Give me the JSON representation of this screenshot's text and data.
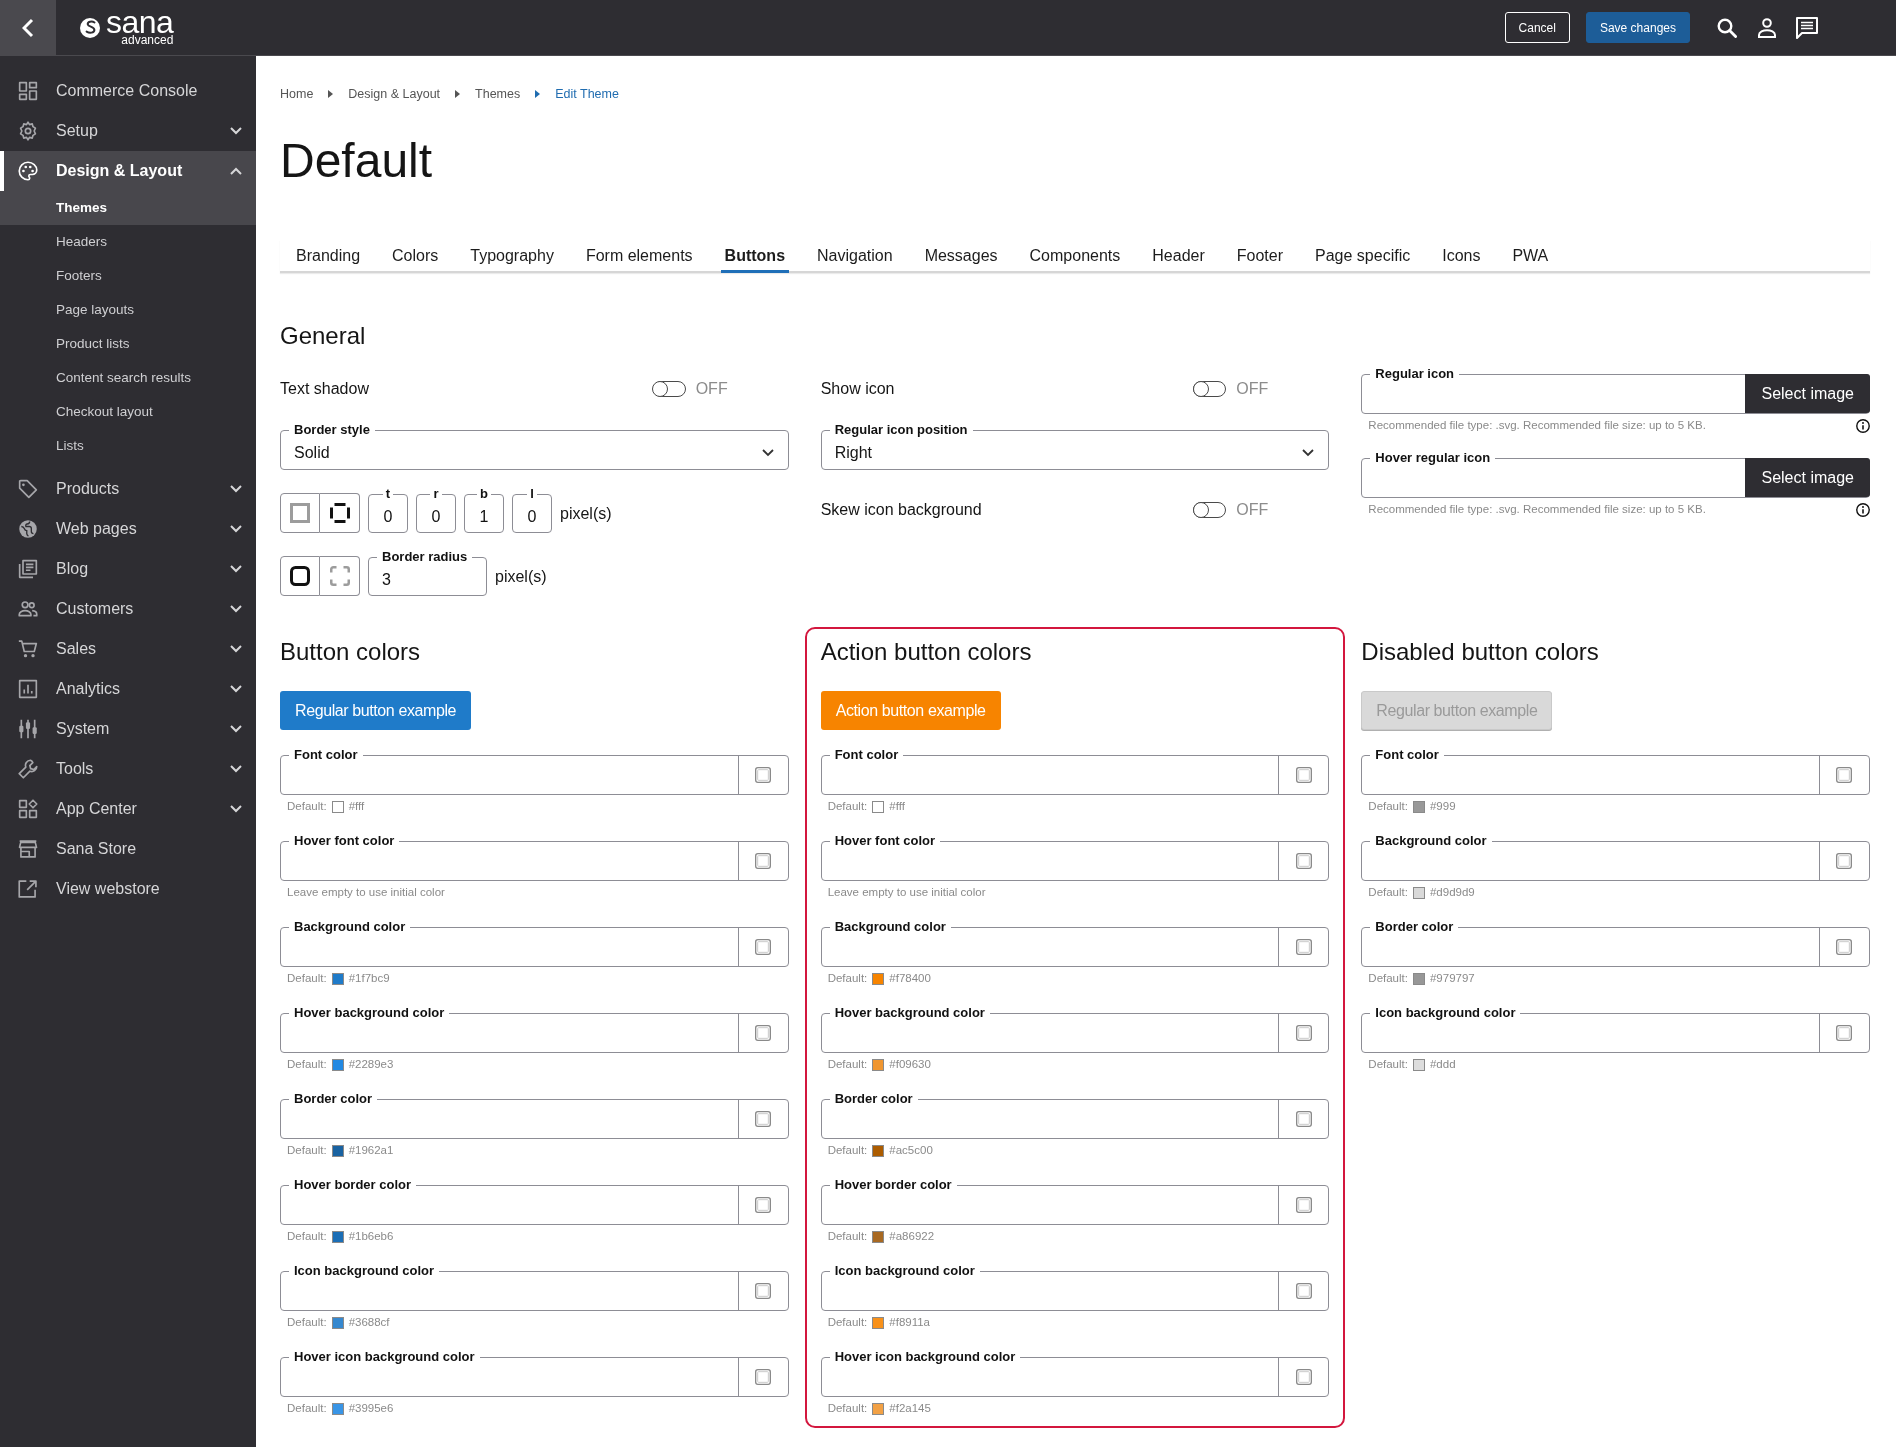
{
  "top_bar": {
    "logo": {
      "wordmark": "sana",
      "edition": "advanced"
    },
    "buttons": [
      {
        "label": "Cancel",
        "kind": "outline"
      },
      {
        "label": "Save changes",
        "kind": "primary"
      }
    ]
  },
  "sidebar": {
    "items": [
      {
        "label": "Commerce Console",
        "kind": "link",
        "selected": false
      },
      {
        "label": "Setup",
        "kind": "group",
        "selected": false,
        "expanded": false
      },
      {
        "label": "Design & Layout",
        "kind": "group",
        "selected": true,
        "expanded": true,
        "children": [
          {
            "label": "Themes",
            "selected": true
          },
          {
            "label": "Headers",
            "selected": false
          },
          {
            "label": "Footers",
            "selected": false
          },
          {
            "label": "Page layouts",
            "selected": false
          },
          {
            "label": "Product lists",
            "selected": false
          },
          {
            "label": "Content search results",
            "selected": false
          },
          {
            "label": "Checkout layout",
            "selected": false
          },
          {
            "label": "Lists",
            "selected": false
          }
        ]
      },
      {
        "label": "Products",
        "kind": "group",
        "selected": false,
        "expanded": false
      },
      {
        "label": "Web pages",
        "kind": "group",
        "selected": false,
        "expanded": false
      },
      {
        "label": "Blog",
        "kind": "group",
        "selected": false,
        "expanded": false
      },
      {
        "label": "Customers",
        "kind": "group",
        "selected": false,
        "expanded": false
      },
      {
        "label": "Sales",
        "kind": "group",
        "selected": false,
        "expanded": false
      },
      {
        "label": "Analytics",
        "kind": "group",
        "selected": false,
        "expanded": false
      },
      {
        "label": "System",
        "kind": "group",
        "selected": false,
        "expanded": false
      },
      {
        "label": "Tools",
        "kind": "group",
        "selected": false,
        "expanded": false
      },
      {
        "label": "App Center",
        "kind": "group",
        "selected": false,
        "expanded": false
      },
      {
        "label": "Sana Store",
        "kind": "link",
        "selected": false
      },
      {
        "label": "View webstore",
        "kind": "link",
        "selected": false
      }
    ]
  },
  "breadcrumb": [
    {
      "label": "Home",
      "current": false
    },
    {
      "label": "Design & Layout",
      "current": false
    },
    {
      "label": "Themes",
      "current": false
    },
    {
      "label": "Edit Theme",
      "current": true
    }
  ],
  "page_title": "Default",
  "tabs": [
    {
      "label": "Branding",
      "selected": false
    },
    {
      "label": "Colors",
      "selected": false
    },
    {
      "label": "Typography",
      "selected": false
    },
    {
      "label": "Form elements",
      "selected": false
    },
    {
      "label": "Buttons",
      "selected": true
    },
    {
      "label": "Navigation",
      "selected": false
    },
    {
      "label": "Messages",
      "selected": false
    },
    {
      "label": "Components",
      "selected": false
    },
    {
      "label": "Header",
      "selected": false
    },
    {
      "label": "Footer",
      "selected": false
    },
    {
      "label": "Page specific",
      "selected": false
    },
    {
      "label": "Icons",
      "selected": false
    },
    {
      "label": "PWA",
      "selected": false
    }
  ],
  "general": {
    "title": "General",
    "columns": [
      {
        "rows": [
          {
            "kind": "toggle",
            "label": "Text shadow",
            "on": false,
            "state_text": "OFF"
          },
          {
            "kind": "select",
            "label": "Border style",
            "value": "Solid"
          },
          {
            "kind": "sides",
            "modes": [
              {
                "selected": false
              },
              {
                "selected": true
              }
            ],
            "fields": [
              {
                "label": "t",
                "value": "0"
              },
              {
                "label": "r",
                "value": "0"
              },
              {
                "label": "b",
                "value": "1"
              },
              {
                "label": "l",
                "value": "0"
              }
            ],
            "unit": "pixel(s)"
          },
          {
            "kind": "radius",
            "modes": [
              {
                "selected": true
              },
              {
                "selected": false
              }
            ],
            "fields": [
              {
                "label": "Border radius",
                "value": "3"
              }
            ],
            "unit": "pixel(s)"
          }
        ]
      },
      {
        "rows": [
          {
            "kind": "toggle",
            "label": "Show icon",
            "on": false,
            "state_text": "OFF"
          },
          {
            "kind": "select",
            "label": "Regular icon position",
            "value": "Right"
          },
          {
            "kind": "toggle",
            "label": "Skew icon background",
            "on": false,
            "state_text": "OFF"
          }
        ]
      },
      {
        "rows": [
          {
            "kind": "file",
            "label": "Regular icon",
            "button": "Select image",
            "hint": "Recommended file type: .svg. Recommended file size: up to 5 KB."
          },
          {
            "kind": "file",
            "label": "Hover regular icon",
            "button": "Select image",
            "hint": "Recommended file type: .svg. Recommended file size: up to 5 KB."
          }
        ]
      }
    ]
  },
  "color_sections": [
    {
      "title": "Button colors",
      "highlighted": false,
      "example": {
        "label": "Regular button example",
        "color": "#1f7bc9",
        "disabled": false
      },
      "fields": [
        {
          "label": "Font color",
          "kind": "default",
          "default_label": "Default:",
          "color": "#ffffff",
          "value": "#fff"
        },
        {
          "label": "Hover font color",
          "kind": "hint",
          "hint": "Leave empty to use initial color"
        },
        {
          "label": "Background color",
          "kind": "default",
          "default_label": "Default:",
          "color": "#1f7bc9",
          "value": "#1f7bc9"
        },
        {
          "label": "Hover background color",
          "kind": "default",
          "default_label": "Default:",
          "color": "#2289e3",
          "value": "#2289e3"
        },
        {
          "label": "Border color",
          "kind": "default",
          "default_label": "Default:",
          "color": "#1962a1",
          "value": "#1962a1"
        },
        {
          "label": "Hover border color",
          "kind": "default",
          "default_label": "Default:",
          "color": "#1b6eb6",
          "value": "#1b6eb6"
        },
        {
          "label": "Icon background color",
          "kind": "default",
          "default_label": "Default:",
          "color": "#3688cf",
          "value": "#3688cf"
        },
        {
          "label": "Hover icon background color",
          "kind": "default",
          "default_label": "Default:",
          "color": "#3995e6",
          "value": "#3995e6"
        }
      ]
    },
    {
      "title": "Action button colors",
      "highlighted": true,
      "example": {
        "label": "Action button example",
        "color": "#f78400",
        "disabled": false
      },
      "fields": [
        {
          "label": "Font color",
          "kind": "default",
          "default_label": "Default:",
          "color": "#ffffff",
          "value": "#fff"
        },
        {
          "label": "Hover font color",
          "kind": "hint",
          "hint": "Leave empty to use initial color"
        },
        {
          "label": "Background color",
          "kind": "default",
          "default_label": "Default:",
          "color": "#f78400",
          "value": "#f78400"
        },
        {
          "label": "Hover background color",
          "kind": "default",
          "default_label": "Default:",
          "color": "#f09630",
          "value": "#f09630"
        },
        {
          "label": "Border color",
          "kind": "default",
          "default_label": "Default:",
          "color": "#ac5c00",
          "value": "#ac5c00"
        },
        {
          "label": "Hover border color",
          "kind": "default",
          "default_label": "Default:",
          "color": "#a86922",
          "value": "#a86922"
        },
        {
          "label": "Icon background color",
          "kind": "default",
          "default_label": "Default:",
          "color": "#f8911a",
          "value": "#f8911a"
        },
        {
          "label": "Hover icon background color",
          "kind": "default",
          "default_label": "Default:",
          "color": "#f2a145",
          "value": "#f2a145"
        }
      ]
    },
    {
      "title": "Disabled button colors",
      "highlighted": false,
      "example": {
        "label": "Regular button example",
        "color": "#d9d9d9",
        "disabled": true
      },
      "fields": [
        {
          "label": "Font color",
          "kind": "default",
          "default_label": "Default:",
          "color": "#999999",
          "value": "#999"
        },
        {
          "label": "Background color",
          "kind": "default",
          "default_label": "Default:",
          "color": "#d9d9d9",
          "value": "#d9d9d9"
        },
        {
          "label": "Border color",
          "kind": "default",
          "default_label": "Default:",
          "color": "#979797",
          "value": "#979797"
        },
        {
          "label": "Icon background color",
          "kind": "default",
          "default_label": "Default:",
          "color": "#dddddd",
          "value": "#ddd"
        }
      ]
    }
  ]
}
